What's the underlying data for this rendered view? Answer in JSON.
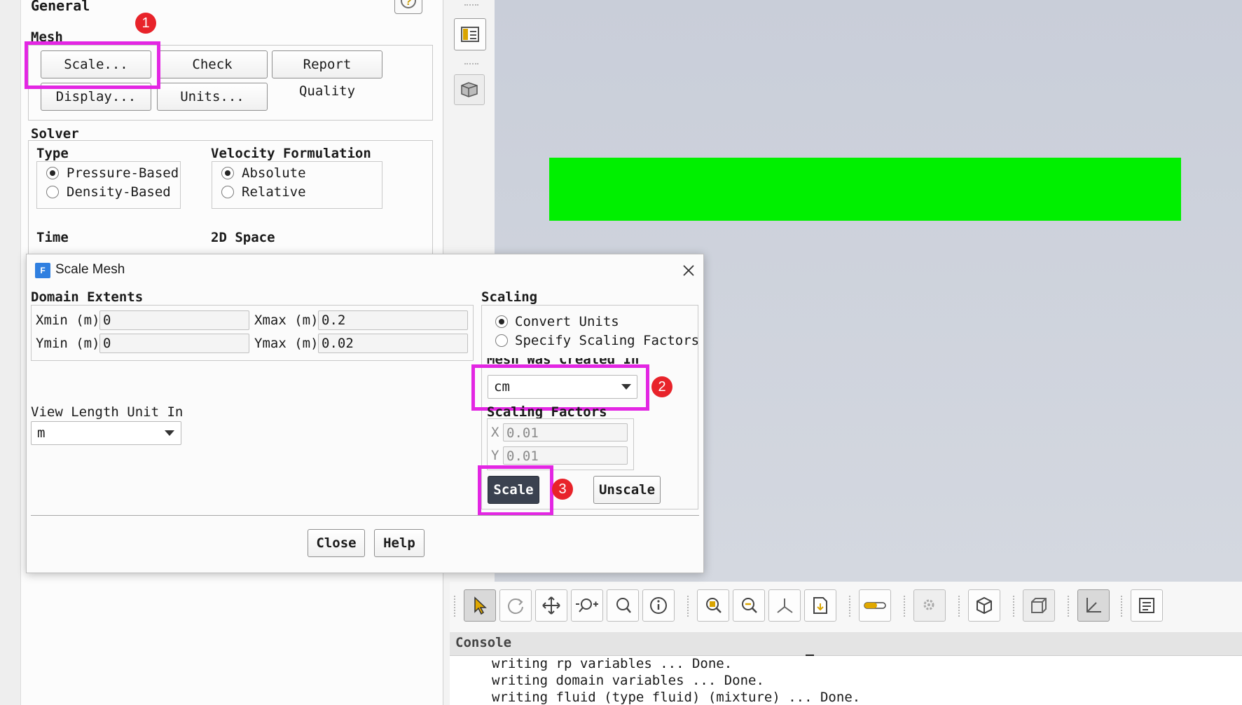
{
  "left_panel": {
    "title": "General",
    "help_icon": "?",
    "mesh": {
      "label": "Mesh",
      "buttons": [
        "Scale...",
        "Check",
        "Report Quality",
        "Display...",
        "Units..."
      ]
    },
    "solver": {
      "label": "Solver",
      "type_label": "Type",
      "type_options": [
        "Pressure-Based",
        "Density-Based"
      ],
      "type_selected": "Pressure-Based",
      "velocity_label": "Velocity Formulation",
      "velocity_options": [
        "Absolute",
        "Relative"
      ],
      "velocity_selected": "Absolute"
    },
    "time_label": "Time",
    "space_label": "2D Space"
  },
  "dialog": {
    "title": "Scale Mesh",
    "app_icon_letter": "F",
    "domain_extents": {
      "label": "Domain Extents",
      "xmin_label": "Xmin (m)",
      "xmin": "0",
      "xmax_label": "Xmax (m)",
      "xmax": "0.2",
      "ymin_label": "Ymin (m)",
      "ymin": "0",
      "ymax_label": "Ymax (m)",
      "ymax": "0.02"
    },
    "view_length": {
      "label": "View Length Unit In",
      "value": "m"
    },
    "scaling": {
      "label": "Scaling",
      "options": [
        "Convert Units",
        "Specify Scaling Factors"
      ],
      "selected": "Convert Units",
      "mesh_created_label": "Mesh Was Created In",
      "mesh_created_value": "cm",
      "factors_label": "Scaling Factors",
      "x_label": "X",
      "x_value": "0.01",
      "y_label": "Y",
      "y_value": "0.01",
      "scale_button": "Scale",
      "unscale_button": "Unscale"
    },
    "close_button": "Close",
    "help_button": "Help"
  },
  "annotations": {
    "step1": "1",
    "step2": "2",
    "step3": "3",
    "highlight_color": "#e326e3",
    "badge_color": "#e8232a"
  },
  "graphics": {
    "mesh_color": "#00f000",
    "background": "#cdd2dc"
  },
  "console": {
    "title": "Console",
    "lines": [
      "writing rp variables ... Done.",
      "writing domain variables ... Done.",
      "writing fluid (type fluid) (mixture) ... Done."
    ]
  },
  "toolbar": {
    "icons": [
      "select-pointer-icon",
      "rotate-icon",
      "pan-icon",
      "zoom-in-out-icon",
      "zoom-icon",
      "probe-info-icon",
      "zoom-to-fit-icon",
      "zoom-box-icon",
      "axes-icon",
      "save-picture-icon",
      "transparency-icon",
      "view-settings-icon",
      "isometric-view-icon",
      "view-cube-icon",
      "2d-axes-icon",
      "notes-icon"
    ]
  }
}
